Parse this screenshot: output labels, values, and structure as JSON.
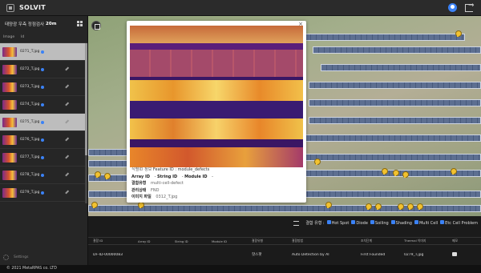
{
  "app": {
    "brand": "SOLVIT"
  },
  "sidebar": {
    "title_prefix": "태양광 우측 정점검사",
    "title_suffix": "20m",
    "columns": {
      "image": "Image",
      "id": "Id"
    },
    "items": [
      {
        "label": "0271_T.jpg",
        "selected": true
      },
      {
        "label": "0272_T.jpg",
        "selected": false
      },
      {
        "label": "0273_T.jpg",
        "selected": false
      },
      {
        "label": "0274_T.jpg",
        "selected": false
      },
      {
        "label": "0275_T.jpg",
        "selected": true
      },
      {
        "label": "0276_T.jpg",
        "selected": false
      },
      {
        "label": "0277_T.jpg",
        "selected": false
      },
      {
        "label": "0278_T.jpg",
        "selected": false
      },
      {
        "label": "0279_T.jpg",
        "selected": false
      }
    ],
    "settings_label": "Settings"
  },
  "popup": {
    "close": "×",
    "line1_label": "식별ID 정보",
    "line1_value": "Feature ID : module_defects",
    "line2": {
      "array": "Array ID",
      "array_val": "-",
      "string": "String ID",
      "string_val": "-",
      "module": "Module ID",
      "module_val": "-"
    },
    "defect_type_label": "결함유형",
    "defect_type_value": "multi-cell-defect",
    "status_label": "관리상태",
    "status_value": "FND",
    "image_file_label": "이미지 파일",
    "image_file_value": "0312_T.jpg"
  },
  "filters": {
    "label": "결함 유형 :",
    "items": [
      "Hot Spot",
      "Diode",
      "Soiling",
      "Shading",
      "Multi Cell",
      "Etc Cell Problem"
    ]
  },
  "table": {
    "headers": [
      "결함 ID",
      "Array ID",
      "String ID",
      "Module ID",
      "결함유형",
      "결함방법",
      "조치단계",
      "Thermal 이미지",
      "메모"
    ],
    "row": [
      "DF-ID-00000083",
      "",
      "",
      "",
      "핫스팟",
      "Auto Detection by AI",
      "First Founded",
      "0279_T.jpg",
      ""
    ]
  },
  "footer": "© 2021 MetaRPAS co. LTD"
}
